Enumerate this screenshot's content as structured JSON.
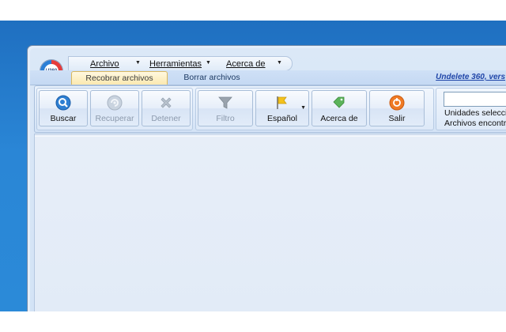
{
  "menu": {
    "archivo": "Archivo",
    "herramientas": "Herramientas",
    "acerca": "Acerca de"
  },
  "logo_text": "U360",
  "tabs": [
    {
      "label": "Recobrar archivos",
      "active": true
    },
    {
      "label": "Borrar archivos",
      "active": false
    }
  ],
  "version_link": "Undelete 360, vers",
  "toolbar": {
    "buscar": "Buscar",
    "recuperar": "Recuperar",
    "detener": "Detener",
    "filtro": "Filtro",
    "idioma": "Español",
    "acerca": "Acerca de",
    "salir": "Salir"
  },
  "side": {
    "path_value": "",
    "unidades": "Unidades seleccionad",
    "archivos": "Archivos encontrado"
  },
  "colors": {
    "desktop": "#2a86d6",
    "link": "#1f45a8",
    "active_tab": "#fbe9b0"
  }
}
